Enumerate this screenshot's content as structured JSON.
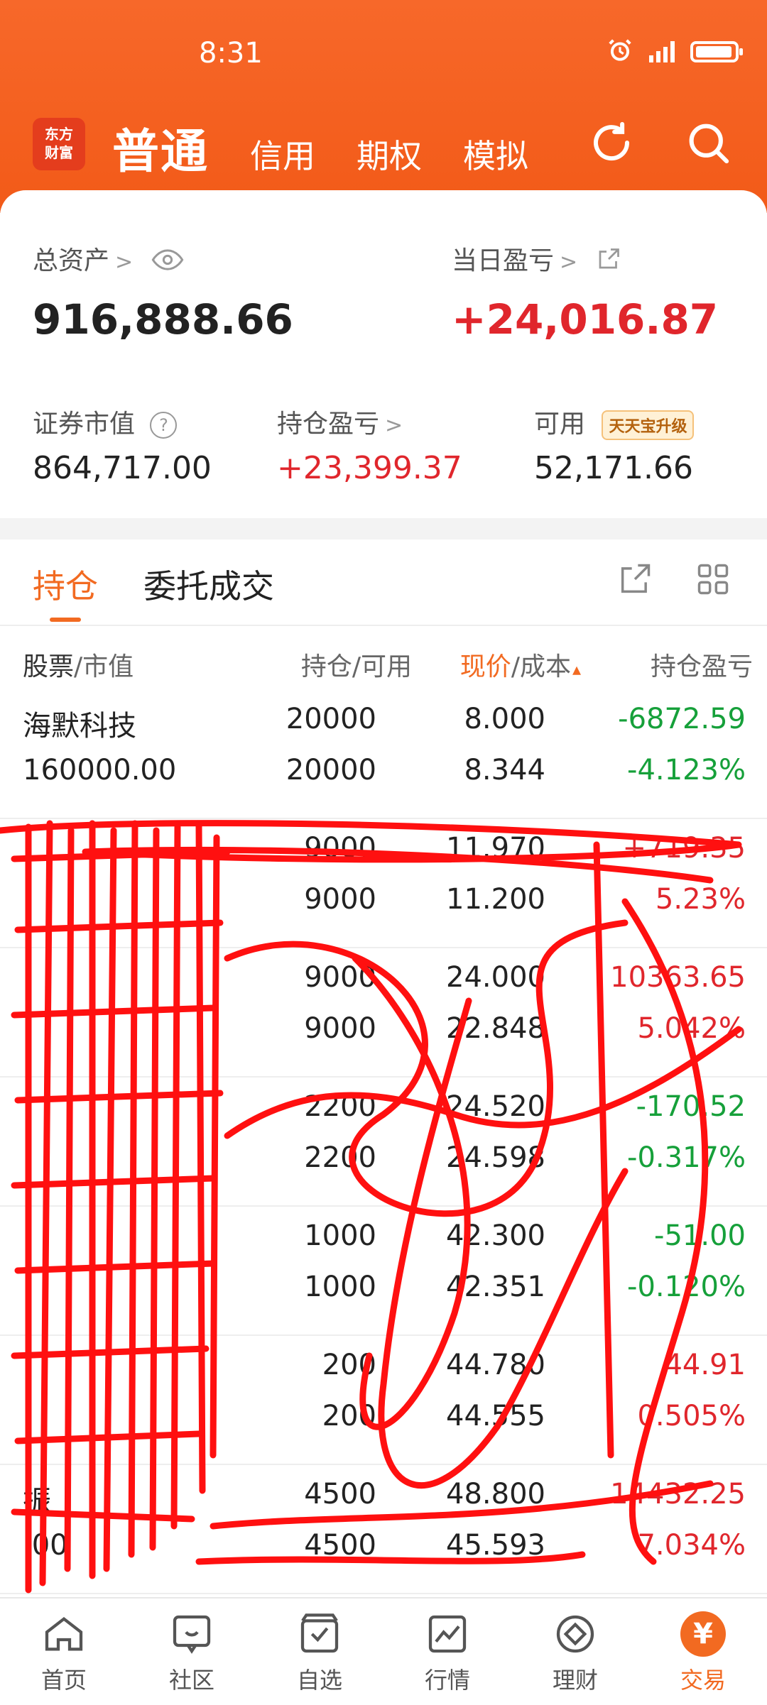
{
  "status": {
    "time": "8:31"
  },
  "header": {
    "logo_line1": "东方",
    "logo_line2": "财富",
    "tabs": [
      "普通",
      "信用",
      "期权",
      "模拟"
    ]
  },
  "summary": {
    "total_assets_label": "总资产",
    "total_assets_value": "916,888.66",
    "daily_pl_label": "当日盈亏",
    "daily_pl_value": "+24,016.87",
    "market_value_label": "证券市值",
    "market_value_value": "864,717.00",
    "position_pl_label": "持仓盈亏",
    "position_pl_value": "+23,399.37",
    "available_label": "可用",
    "available_badge": "天天宝升级",
    "available_value": "52,171.66"
  },
  "holdings_tabs": {
    "hold": "持仓",
    "entrust": "委托成交"
  },
  "columns": {
    "stock": "股票",
    "market_value": "/市值",
    "hold_avail": "持仓/可用",
    "price": "现价",
    "cost": "/成本",
    "pl": "持仓盈亏"
  },
  "rows": [
    {
      "name": "海默科技",
      "value": "160000.00",
      "hold": "20000",
      "avail": "20000",
      "price": "8.000",
      "cost": "8.344",
      "pl": "-6872.59",
      "pl_pct": "-4.123%",
      "dir": "down"
    },
    {
      "name": "",
      "value": "",
      "hold": "9000",
      "avail": "9000",
      "price": "11.970",
      "cost": "11.200",
      "pl": "+719.35",
      "pl_pct": "5.23%",
      "dir": "up"
    },
    {
      "name": "",
      "value": "",
      "hold": "9000",
      "avail": "9000",
      "price": "24.000",
      "cost": "22.848",
      "pl": "10363.65",
      "pl_pct": "5.042%",
      "dir": "up"
    },
    {
      "name": "",
      "value": "",
      "hold": "2200",
      "avail": "2200",
      "price": "24.520",
      "cost": "24.598",
      "pl": "-170.52",
      "pl_pct": "-0.317%",
      "dir": "down"
    },
    {
      "name": "",
      "value": "",
      "hold": "1000",
      "avail": "1000",
      "price": "42.300",
      "cost": "42.351",
      "pl": "-51.00",
      "pl_pct": "-0.120%",
      "dir": "down"
    },
    {
      "name": "",
      "value": "",
      "hold": "200",
      "avail": "200",
      "price": "44.780",
      "cost": "44.555",
      "pl": "44.91",
      "pl_pct": "0.505%",
      "dir": "up"
    },
    {
      "name": "振",
      "value": ".00",
      "hold": "4500",
      "avail": "4500",
      "price": "48.800",
      "cost": "45.593",
      "pl": "14432.25",
      "pl_pct": "7.034%",
      "dir": "up"
    }
  ],
  "bottom_nav": [
    "首页",
    "社区",
    "自选",
    "行情",
    "理财",
    "交易"
  ],
  "trade_symbol": "¥",
  "colors": {
    "brand": "#f26a21",
    "up": "#e0262c",
    "down": "#16a03a",
    "scribble": "#ff0000"
  }
}
